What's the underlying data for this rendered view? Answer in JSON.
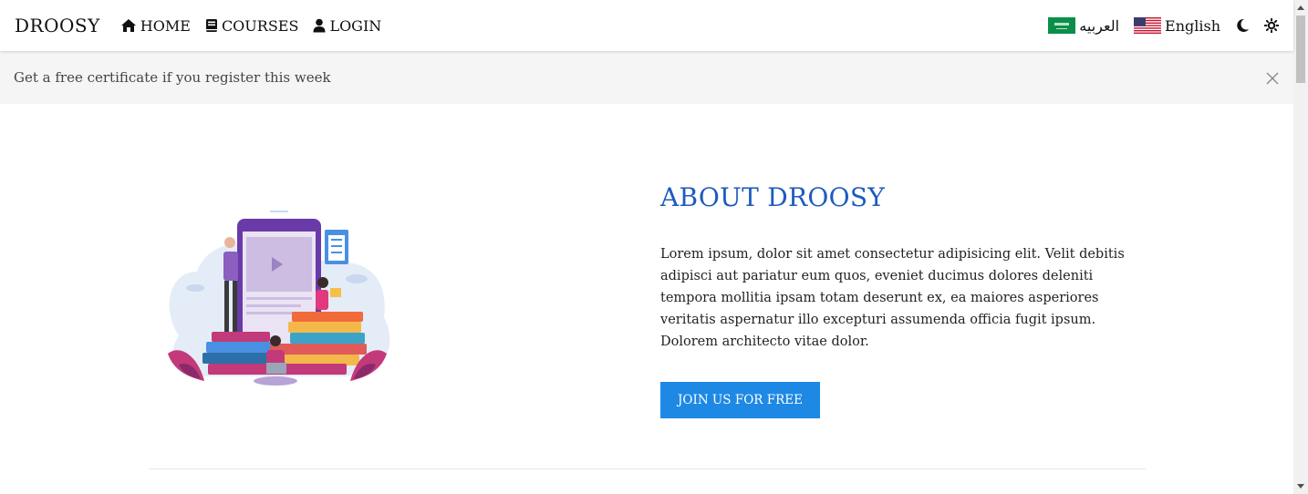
{
  "navbar": {
    "brand": "DROOSY",
    "links": [
      {
        "label": "HOME",
        "icon": "home-icon"
      },
      {
        "label": "COURSES",
        "icon": "book-icon"
      },
      {
        "label": "LOGIN",
        "icon": "user-icon"
      }
    ],
    "languages": [
      {
        "label": "العربيه",
        "flag": "saudi-flag-icon"
      },
      {
        "label": "English",
        "flag": "us-flag-icon"
      }
    ],
    "theme_icons": [
      "moon-icon",
      "sun-icon"
    ]
  },
  "announcement": {
    "text": "Get a free certificate if you register this week",
    "close_icon": "close-icon"
  },
  "about": {
    "title": "ABOUT DROOSY",
    "body": "Lorem ipsum, dolor sit amet consectetur adipisicing elit. Velit debitis adipisci aut pariatur eum quos, eveniet ducimus dolores deleniti tempora mollitia ipsam totam deserunt ex, ea maiores asperiores veritatis aspernatur illo excepturi assumenda officia fugit ipsum. Dolorem architecto vitae dolor.",
    "cta_label": "JOIN US FOR FREE"
  },
  "colors": {
    "title": "#1e5bbf",
    "button": "#1e88e5",
    "announcement_bg": "#f5f5f5"
  }
}
